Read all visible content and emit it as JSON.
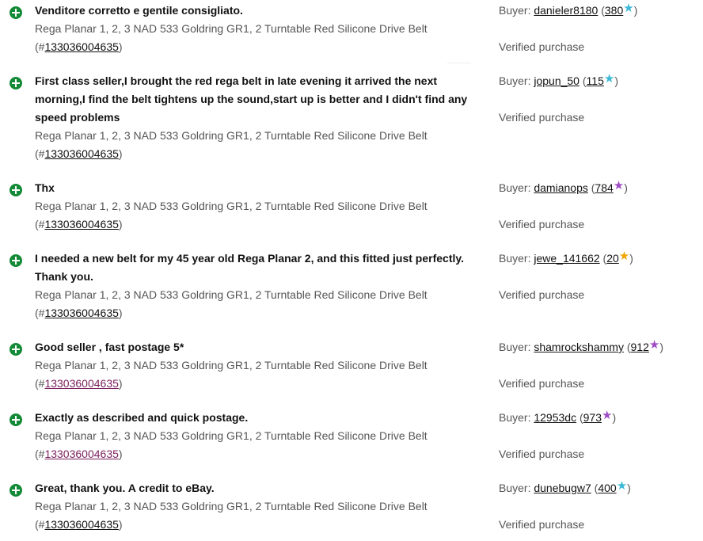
{
  "feedback": [
    {
      "comment": "Venditore corretto e gentile consigliato.",
      "item_title": "Rega Planar 1, 2, 3 NAD 533 Goldring GR1, 2 Turntable Red Silicone Drive Belt",
      "item_number": "133036004635",
      "item_link_visited": false,
      "buyer_label": "Buyer:",
      "buyer_name": "danieler8180",
      "buyer_score": "380",
      "star_color": "teal",
      "verified": "Verified purchase"
    },
    {
      "comment": "First class seller,I brought the red rega belt in late evening it arrived the next morning,I find the belt tightens up the sound,start up is better and I didn't find any speed problems",
      "item_title": "Rega Planar 1, 2, 3 NAD 533 Goldring GR1, 2 Turntable Red Silicone Drive Belt",
      "item_number": "133036004635",
      "item_link_visited": false,
      "buyer_label": "Buyer:",
      "buyer_name": "jopun_50",
      "buyer_score": "115",
      "star_color": "teal",
      "verified": "Verified purchase"
    },
    {
      "comment": "Thx",
      "item_title": "Rega Planar 1, 2, 3 NAD 533 Goldring GR1, 2 Turntable Red Silicone Drive Belt",
      "item_number": "133036004635",
      "item_link_visited": false,
      "buyer_label": "Buyer:",
      "buyer_name": "damianops",
      "buyer_score": "784",
      "star_color": "purple",
      "verified": "Verified purchase"
    },
    {
      "comment": "I needed a new belt for my 45 year old Rega Planar 2, and this fitted just perfectly. Thank you.",
      "item_title": "Rega Planar 1, 2, 3 NAD 533 Goldring GR1, 2 Turntable Red Silicone Drive Belt",
      "item_number": "133036004635",
      "item_link_visited": false,
      "buyer_label": "Buyer:",
      "buyer_name": "jewe_141662",
      "buyer_score": "20",
      "star_color": "yellow",
      "verified": "Verified purchase"
    },
    {
      "comment": "Good seller , fast postage 5*",
      "item_title": "Rega Planar 1, 2, 3 NAD 533 Goldring GR1, 2 Turntable Red Silicone Drive Belt",
      "item_number": "133036004635",
      "item_link_visited": true,
      "buyer_label": "Buyer:",
      "buyer_name": "shamrockshammy",
      "buyer_score": "912",
      "star_color": "purple",
      "verified": "Verified purchase"
    },
    {
      "comment": "Exactly as described and quick postage.",
      "item_title": "Rega Planar 1, 2, 3 NAD 533 Goldring GR1, 2 Turntable Red Silicone Drive Belt",
      "item_number": "133036004635",
      "item_link_visited": true,
      "buyer_label": "Buyer:",
      "buyer_name": "12953dc",
      "buyer_score": "973",
      "star_color": "purple",
      "verified": "Verified purchase"
    },
    {
      "comment": "Great, thank you. A credit to eBay.",
      "item_title": "Rega Planar 1, 2, 3 NAD 533 Goldring GR1, 2 Turntable Red Silicone Drive Belt",
      "item_number": "133036004635",
      "item_link_visited": false,
      "buyer_label": "Buyer:",
      "buyer_name": "dunebugw7",
      "buyer_score": "400",
      "star_color": "teal",
      "verified": "Verified purchase"
    }
  ],
  "icons": {
    "feedback_type": "positive-feedback-icon",
    "score_star": "star-icon"
  },
  "colors": {
    "positive": "#138a36",
    "star_teal": "#3bb8d8",
    "star_purple": "#a04cc6",
    "star_yellow": "#f0a500",
    "visited_link": "#7a1f5c"
  }
}
